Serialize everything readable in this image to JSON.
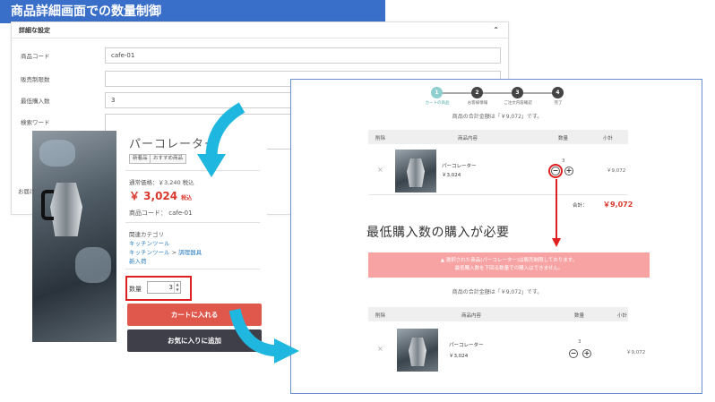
{
  "banner": {
    "title": "商品詳細画面での数量制御"
  },
  "admin": {
    "section_title": "詳細な設定",
    "collapse_icon": "chevron-up-icon",
    "fields": [
      {
        "label": "商品コード",
        "value": "cafe-01"
      },
      {
        "label": "販売制限数",
        "value": ""
      },
      {
        "label": "最低購入数",
        "value": "3"
      },
      {
        "label": "検索ワード",
        "value": ""
      }
    ],
    "partial_label": "お届け"
  },
  "product": {
    "name": "パーコレーター",
    "tags": [
      "新着品",
      "おすすめ商品"
    ],
    "regular_price": "通常価格：￥3,240 税込",
    "price": "￥ 3,024",
    "tax_label": "税込",
    "code": "商品コード： cafe-01",
    "category_title": "関連カテゴリ",
    "categories": [
      "キッチンツール",
      "キッチンツール",
      "調理器具",
      "新入荷"
    ],
    "category_sep": ">",
    "quantity_label": "数量",
    "quantity_value": "3",
    "add_to_cart": "カートに入れる",
    "add_to_favorites": "お気に入りに追加"
  },
  "cart": {
    "steps": [
      {
        "num": "1",
        "label": "カートの商品"
      },
      {
        "num": "2",
        "label": "お客様情報"
      },
      {
        "num": "3",
        "label": "ご注文内容確認"
      },
      {
        "num": "4",
        "label": "完了"
      }
    ],
    "summary_msg": "商品の合計金額は「￥9,072」です。",
    "columns": [
      "削除",
      "商品内容",
      "数量",
      "小計"
    ],
    "item": {
      "name": "パーコレーター",
      "price": "￥3,024",
      "qty": "3",
      "subtotal": "￥9,072"
    },
    "total_label": "合計：",
    "total_value": "￥9,072",
    "note": "最低購入数の購入が必要",
    "alert_line1": "選択された商品(パーコレーター)は販売制限しております。",
    "alert_line2": "最低購入数を下回る数量での購入はできません。",
    "alert_icon": "warning-icon"
  },
  "colors": {
    "banner": "#3a6fc9",
    "price": "#d9382c",
    "alert": "#f7a3a3",
    "highlight": "#e02020",
    "arrow": "#1fb7e0"
  }
}
